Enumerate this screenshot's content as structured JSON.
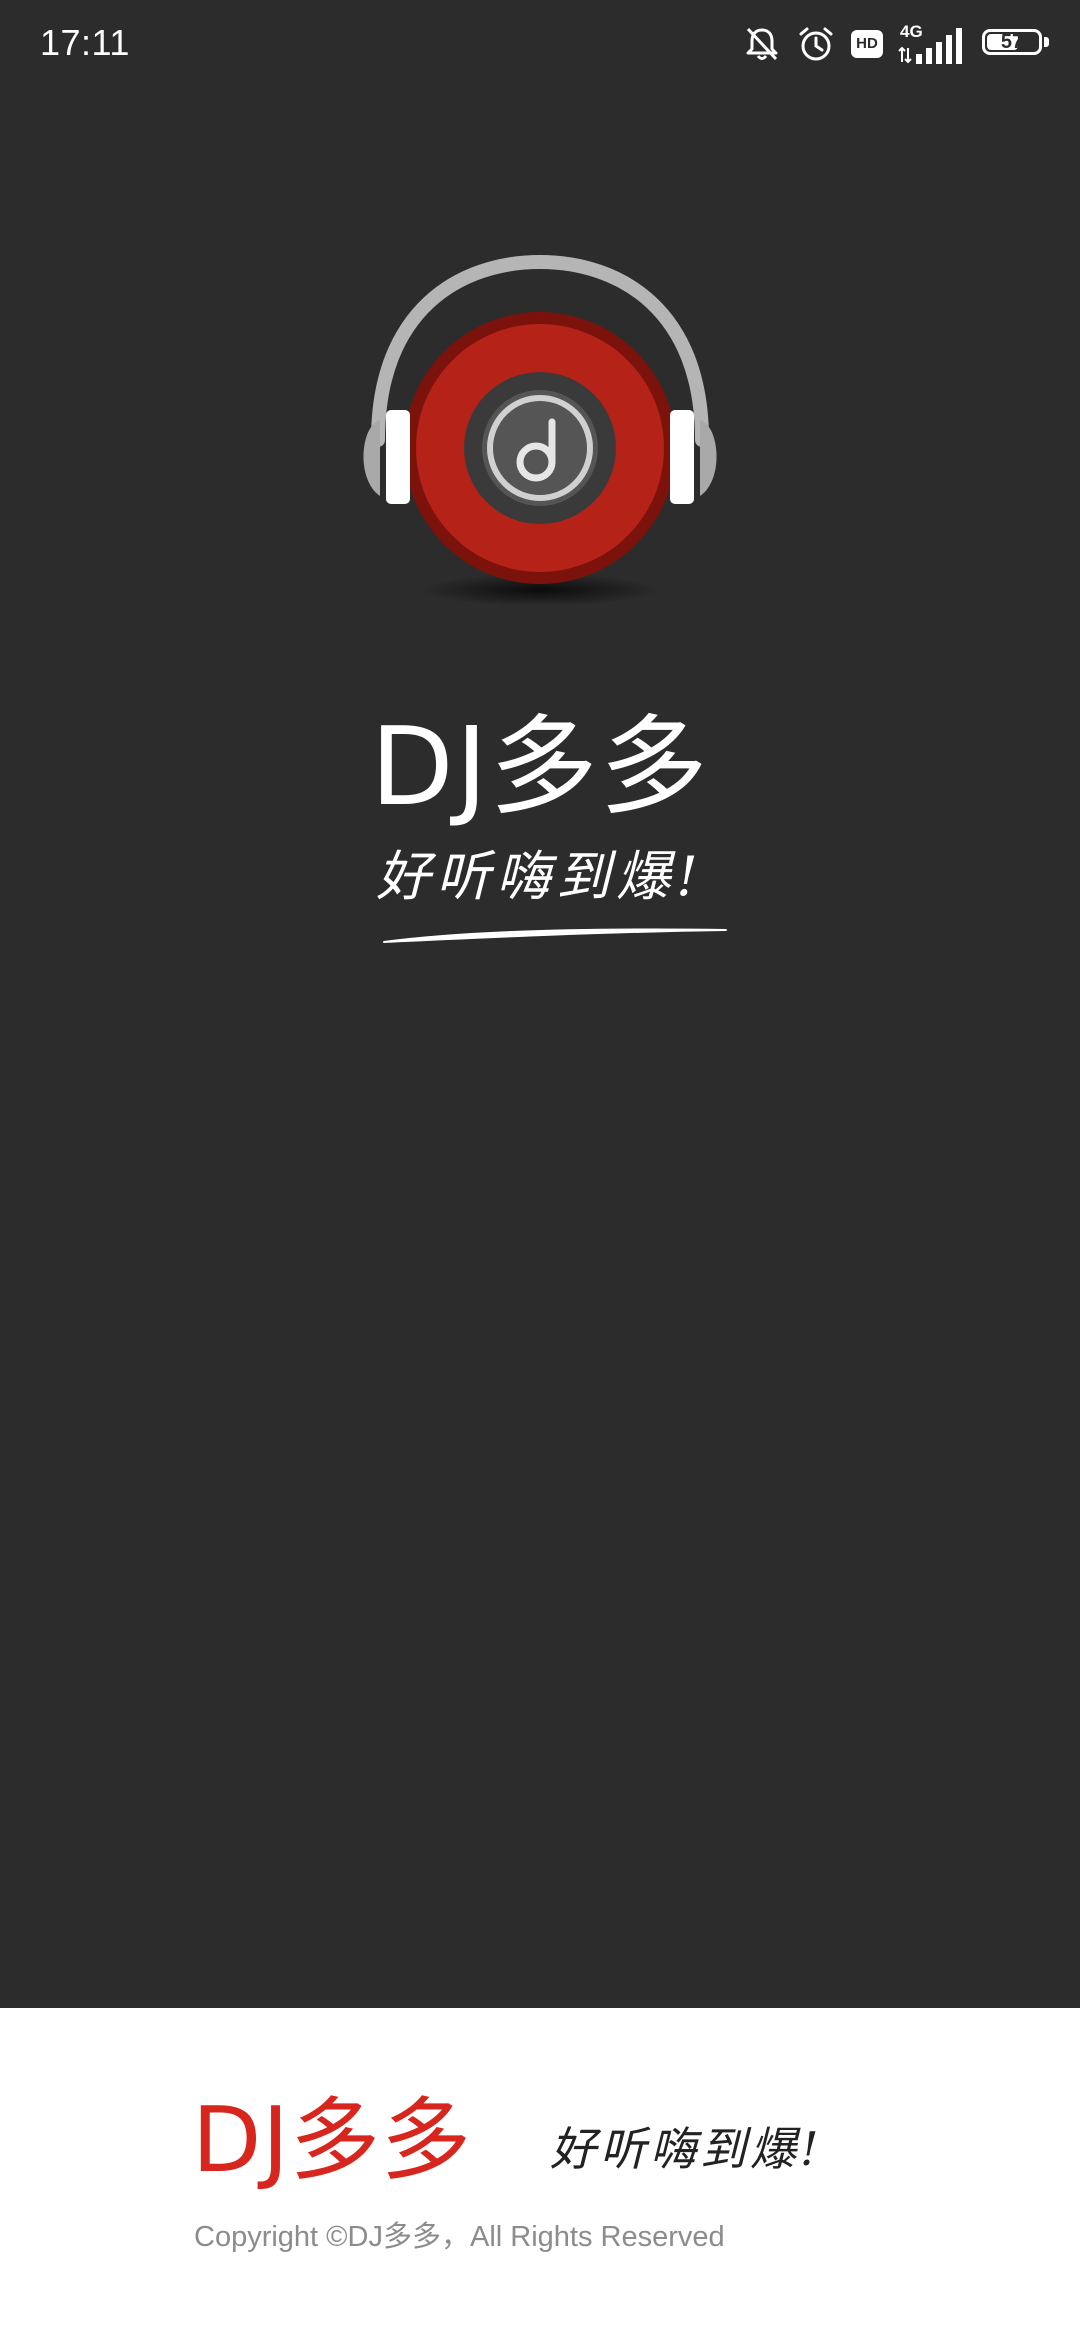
{
  "status_bar": {
    "time": "17:11",
    "network": "4G",
    "hd_label": "HD",
    "battery_level": "57",
    "battery_fraction": 0.57,
    "icons": [
      "bell-off-icon",
      "alarm-icon",
      "hd-icon",
      "signal-icon",
      "battery-icon"
    ]
  },
  "splash": {
    "title": "DJ多多",
    "slogan": "好听嗨到爆!"
  },
  "footer": {
    "brand": "DJ多多",
    "slogan": "好听嗨到爆!",
    "copyright": "Copyright ©DJ多多，All Rights Reserved"
  },
  "colors": {
    "background": "#2c2c2c",
    "footer_background": "#ffffff",
    "brand_red": "#d6261d",
    "disc_red": "#b52217",
    "copyright_gray": "#8c8c8c"
  }
}
